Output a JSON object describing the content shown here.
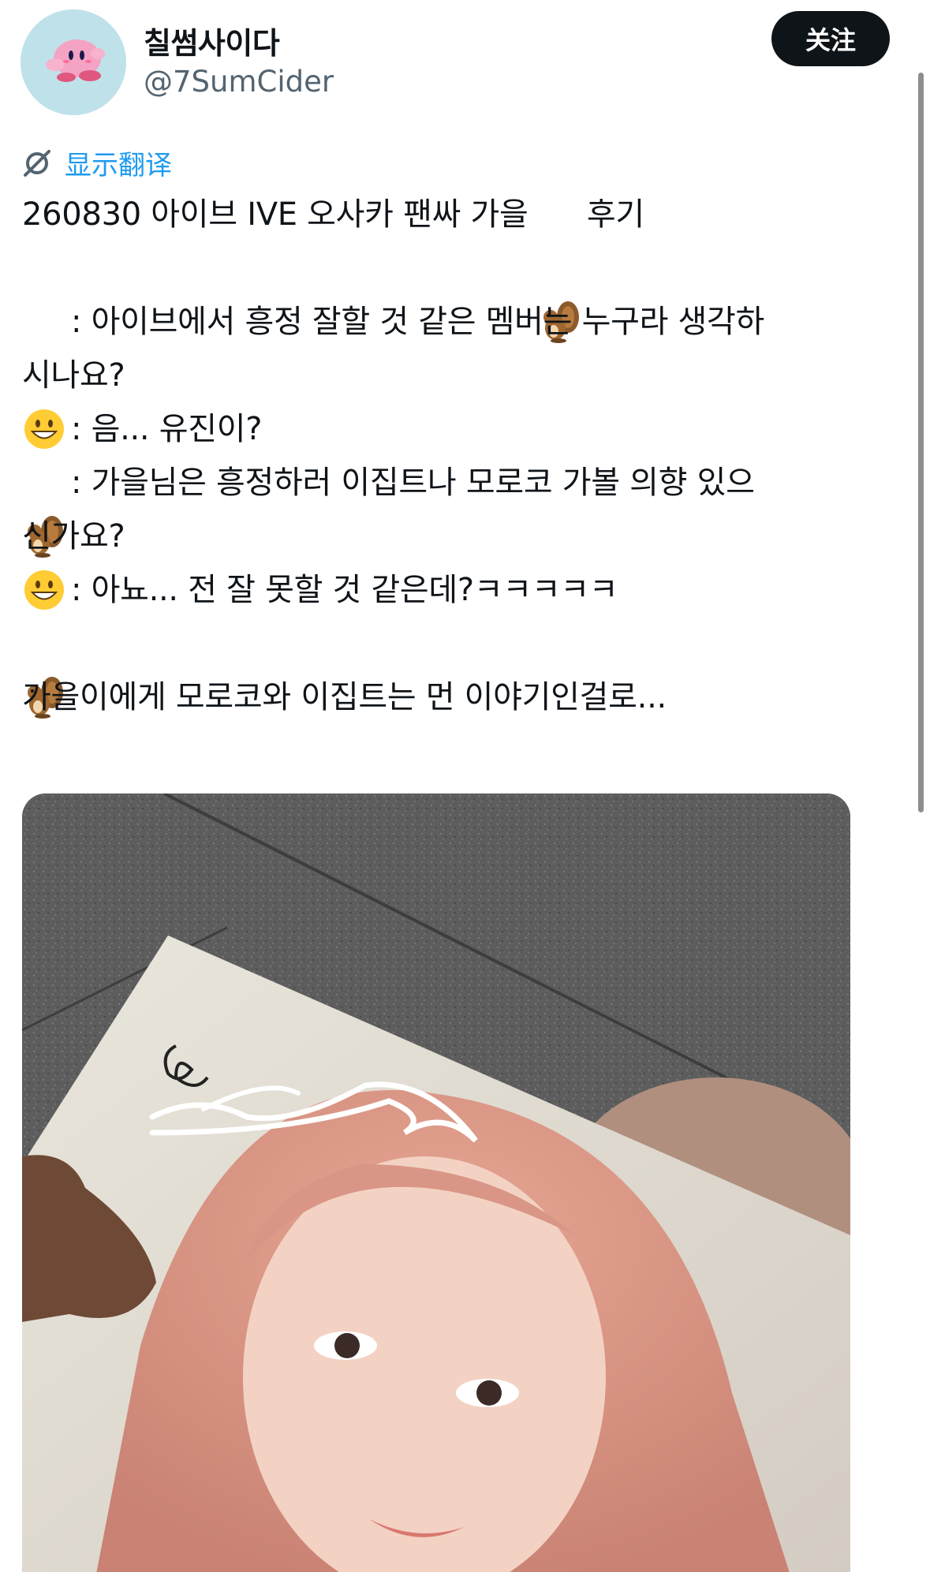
{
  "user": {
    "display_name": "칠썸사이다",
    "handle": "@7SumCider",
    "avatar_icon": "kirby-avatar"
  },
  "follow_label": "关注",
  "translate_label": "显示翻译",
  "tweet": {
    "line1_text": "260830 아이브 IVE 오사카 팬싸 가을 ",
    "line1_suffix": "후기",
    "q1_line1": ": 아이브에서 흥정 잘할 것 같은 멤버는 누구라 생각하",
    "q1_line2": "시나요?",
    "a1": ": 음... 유진이?",
    "q2_line1": ": 가을님은 흥정하러 이집트나 모로코 가볼 의향 있으",
    "q2_line2": "신가요?",
    "a2": ": 아뇨... 전 잘 못할 것 같은데?ㅋㅋㅋㅋㅋ",
    "closing": "가을이에게 모로코와 이집트는 먼 이야기인걸로..."
  },
  "emoji": {
    "grin": "grinning-face-icon",
    "squirrel": "chipmunk-icon"
  },
  "photo": {
    "description_icon": "signed-photocard-image"
  },
  "colors": {
    "accent": "#1d9bf0",
    "button_bg": "#0f1419",
    "secondary_text": "#536471"
  }
}
